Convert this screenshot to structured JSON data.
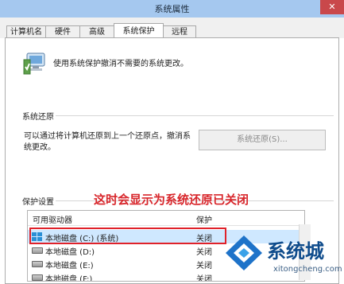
{
  "window": {
    "title": "系统属性",
    "close_glyph": "✕"
  },
  "tabs": [
    "计算机名",
    "硬件",
    "高级",
    "系统保护",
    "远程"
  ],
  "intro": {
    "text": "使用系统保护撤消不需要的系统更改。"
  },
  "system_restore": {
    "group_title": "系统还原",
    "description": "可以通过将计算机还原到上一个还原点，撤消系统更改。",
    "button_label": "系统还原(S)..."
  },
  "protection_settings": {
    "group_title": "保护设置",
    "annotation": "这时会显示为系统还原已关闭",
    "columns": [
      "可用驱动器",
      "保护"
    ],
    "rows": [
      {
        "drive": "本地磁盘 (C:) (系统)",
        "protection": "关闭",
        "icon": "windows-drive-icon"
      },
      {
        "drive": "本地磁盘 (D:)",
        "protection": "关闭",
        "icon": "drive-icon"
      },
      {
        "drive": "本地磁盘 (E:)",
        "protection": "关闭",
        "icon": "drive-icon"
      },
      {
        "drive": "本地磁盘 (F:)",
        "protection": "关闭",
        "icon": "drive-icon"
      }
    ]
  },
  "watermark": {
    "brand": "系统城",
    "domain": "xitongcheng.com"
  },
  "colors": {
    "titlebar": "#a5c8ef",
    "annotation": "#d8262b",
    "highlight_border": "#e0222a",
    "selected_row": "#cfe8ff",
    "brand": "#0f4c8c"
  }
}
